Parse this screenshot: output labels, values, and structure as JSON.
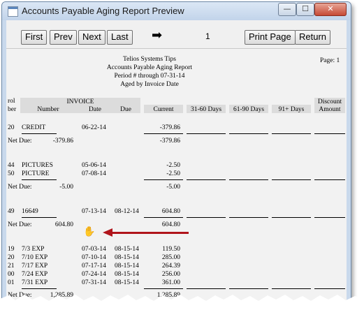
{
  "window": {
    "title": "Accounts Payable Aging Report Preview",
    "min": "—",
    "max": "☐",
    "close": "✕"
  },
  "toolbar": {
    "first": "First",
    "prev": "Prev",
    "next": "Next",
    "last": "Last",
    "page_number": "1",
    "print_page": "Print Page",
    "return": "Return",
    "arrow": "➡"
  },
  "report": {
    "company": "Telios Systems Tips",
    "title": "Accounts Payable Aging Report",
    "period": "Period # through 07-31-14",
    "aged_by": "Aged by Invoice Date",
    "page_label": "Page: 1",
    "columns": {
      "control_1": "rol",
      "control_2": "ber",
      "invoice_group": "INVOICE",
      "number": "Number",
      "date": "Date",
      "due": "Due",
      "current": "Current",
      "d31_60": "31-60 Days",
      "d61_90": "61-90 Days",
      "d91": "91+ Days",
      "discount_1": "Discount",
      "discount_2": "Amount"
    },
    "net_due_label": "Net Due:",
    "rows": [
      {
        "ctrl": "20",
        "number": "CREDIT",
        "date": "06-22-14",
        "due": "",
        "current": "-379.86"
      },
      {
        "ctrl": "44",
        "number": "PICTURES",
        "date": "05-06-14",
        "due": "",
        "current": "-2.50"
      },
      {
        "ctrl": "50",
        "number": "PICTURE",
        "date": "07-08-14",
        "due": "",
        "current": "-2.50"
      },
      {
        "ctrl": "49",
        "number": "16649",
        "date": "07-13-14",
        "due": "08-12-14",
        "current": "604.80"
      },
      {
        "ctrl": "19",
        "number": "7/3 EXP",
        "date": "07-03-14",
        "due": "08-15-14",
        "current": "119.50"
      },
      {
        "ctrl": "20",
        "number": "7/10 EXP",
        "date": "07-10-14",
        "due": "08-15-14",
        "current": "285.00"
      },
      {
        "ctrl": "21",
        "number": "7/17 EXP",
        "date": "07-17-14",
        "due": "08-15-14",
        "current": "264.39"
      },
      {
        "ctrl": "00",
        "number": "7/24 EXP",
        "date": "07-24-14",
        "due": "08-15-14",
        "current": "256.00"
      },
      {
        "ctrl": "01",
        "number": "7/31 EXP",
        "date": "07-31-14",
        "due": "08-15-14",
        "current": "361.00"
      }
    ],
    "groups": [
      {
        "net_due": "-379.86",
        "current_total": "-379.86"
      },
      {
        "net_due": "-5.00",
        "current_total": "-5.00"
      },
      {
        "net_due": "604.80",
        "current_total": "604.80"
      },
      {
        "net_due": "1,285.89",
        "current_total": "1,285.89"
      }
    ]
  },
  "icons": {
    "hand": "✋"
  }
}
